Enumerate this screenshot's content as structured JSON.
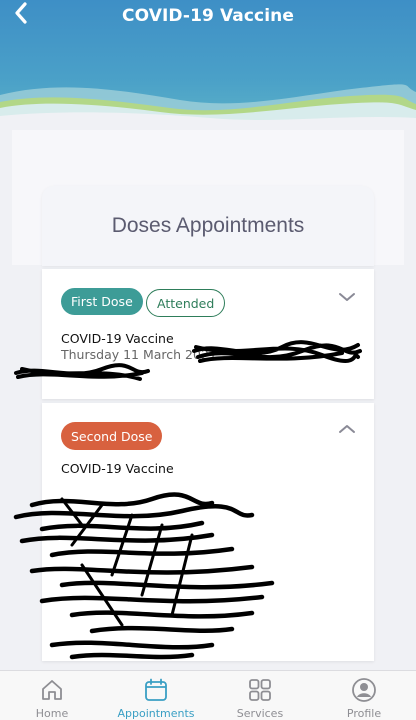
{
  "header": {
    "title": "COVID-19 Vaccine",
    "back_icon": "chevron-left-icon"
  },
  "doses_card": {
    "title": "Doses Appointments"
  },
  "doses": [
    {
      "badge": "First Dose",
      "badge_color": "#3d9c97",
      "status": "Attended",
      "status_color": "#2e7d5a",
      "vaccine": "COVID-19 Vaccine",
      "date": "Thursday 11 March 2021",
      "expanded": false,
      "toggle_icon": "chevron-down-icon"
    },
    {
      "badge": "Second Dose",
      "badge_color": "#d8613f",
      "vaccine": "COVID-19 Vaccine",
      "expanded": true,
      "toggle_icon": "chevron-up-icon"
    }
  ],
  "tabbar": {
    "items": [
      {
        "label": "Home",
        "icon": "home-icon",
        "active": false
      },
      {
        "label": "Appointments",
        "icon": "calendar-icon",
        "active": true
      },
      {
        "label": "Services",
        "icon": "grid-icon",
        "active": false
      },
      {
        "label": "Profile",
        "icon": "profile-icon",
        "active": false
      }
    ],
    "active_color": "#3a9fc4",
    "inactive_color": "#8e8e93"
  }
}
